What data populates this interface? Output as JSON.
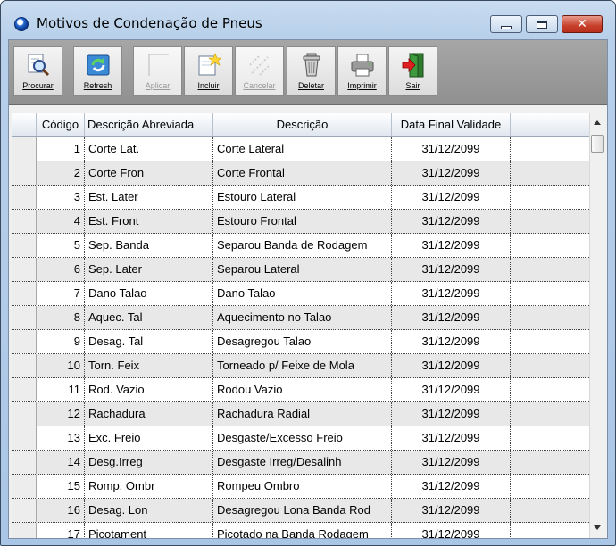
{
  "window": {
    "title": "Motivos de Condenação de Pneus"
  },
  "toolbar": {
    "buttons": [
      {
        "label": "Procurar",
        "icon": "magnifier-icon",
        "enabled": true
      },
      {
        "label": "Refresh",
        "icon": "refresh-icon",
        "enabled": true
      },
      {
        "label": "Aplicar",
        "icon": "apply-icon",
        "enabled": false
      },
      {
        "label": "Incluir",
        "icon": "new-document-icon",
        "enabled": true
      },
      {
        "label": "Cancelar",
        "icon": "cancel-icon",
        "enabled": false
      },
      {
        "label": "Deletar",
        "icon": "trash-icon",
        "enabled": true
      },
      {
        "label": "Imprimir",
        "icon": "printer-icon",
        "enabled": true
      },
      {
        "label": "Sair",
        "icon": "exit-door-icon",
        "enabled": true
      }
    ]
  },
  "grid": {
    "columns": [
      "Código",
      "Descrição Abreviada",
      "Descrição",
      "Data Final Validade"
    ],
    "rows": [
      {
        "codigo": "1",
        "abreviada": "Corte Lat.",
        "descricao": "Corte Lateral",
        "data": "31/12/2099"
      },
      {
        "codigo": "2",
        "abreviada": "Corte Fron",
        "descricao": "Corte Frontal",
        "data": "31/12/2099"
      },
      {
        "codigo": "3",
        "abreviada": "Est. Later",
        "descricao": "Estouro Lateral",
        "data": "31/12/2099"
      },
      {
        "codigo": "4",
        "abreviada": "Est. Front",
        "descricao": "Estouro Frontal",
        "data": "31/12/2099"
      },
      {
        "codigo": "5",
        "abreviada": "Sep. Banda",
        "descricao": "Separou Banda de Rodagem",
        "data": "31/12/2099"
      },
      {
        "codigo": "6",
        "abreviada": "Sep. Later",
        "descricao": "Separou Lateral",
        "data": "31/12/2099"
      },
      {
        "codigo": "7",
        "abreviada": "Dano Talao",
        "descricao": "Dano Talao",
        "data": "31/12/2099"
      },
      {
        "codigo": "8",
        "abreviada": "Aquec. Tal",
        "descricao": "Aquecimento no Talao",
        "data": "31/12/2099"
      },
      {
        "codigo": "9",
        "abreviada": "Desag. Tal",
        "descricao": "Desagregou Talao",
        "data": "31/12/2099"
      },
      {
        "codigo": "10",
        "abreviada": "Torn. Feix",
        "descricao": "Torneado p/ Feixe de Mola",
        "data": "31/12/2099"
      },
      {
        "codigo": "11",
        "abreviada": "Rod. Vazio",
        "descricao": "Rodou Vazio",
        "data": "31/12/2099"
      },
      {
        "codigo": "12",
        "abreviada": "Rachadura",
        "descricao": "Rachadura Radial",
        "data": "31/12/2099"
      },
      {
        "codigo": "13",
        "abreviada": "Exc. Freio",
        "descricao": "Desgaste/Excesso Freio",
        "data": "31/12/2099"
      },
      {
        "codigo": "14",
        "abreviada": "Desg.Irreg",
        "descricao": "Desgaste Irreg/Desalinh",
        "data": "31/12/2099"
      },
      {
        "codigo": "15",
        "abreviada": "Romp. Ombr",
        "descricao": "Rompeu Ombro",
        "data": "31/12/2099"
      },
      {
        "codigo": "16",
        "abreviada": "Desag. Lon",
        "descricao": "Desagregou Lona Banda Rod",
        "data": "31/12/2099"
      },
      {
        "codigo": "17",
        "abreviada": "Picotament",
        "descricao": "Picotado na Banda Rodagem",
        "data": "31/12/2099"
      }
    ]
  }
}
